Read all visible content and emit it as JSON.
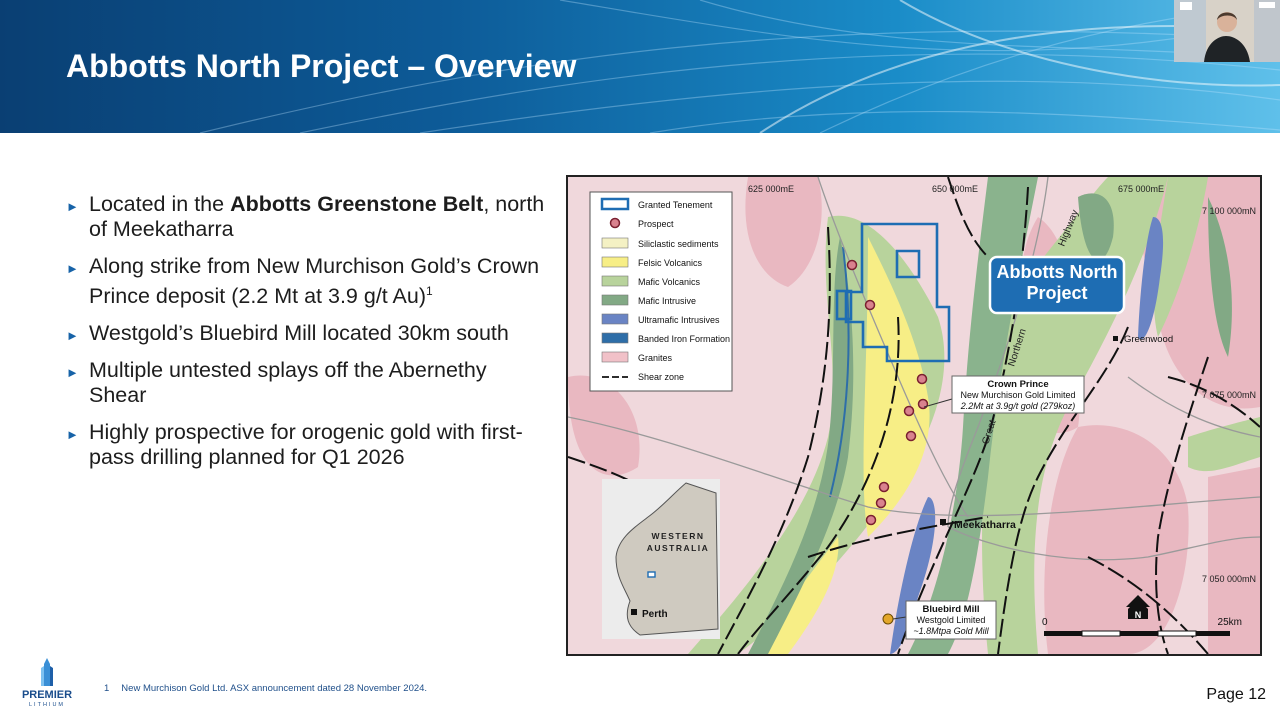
{
  "slide": {
    "title": "Abbotts North Project – Overview",
    "page_label": "Page 12",
    "bullets": [
      {
        "pre": "Located in the ",
        "bold": "Abbotts Greenstone Belt",
        "post": ", north of Meekatharra",
        "sup": ""
      },
      {
        "pre": "Along strike from New Murchison Gold’s Crown Prince deposit (2.2 Mt at 3.9 g/t Au)",
        "bold": "",
        "post": "",
        "sup": "1"
      },
      {
        "pre": "Westgold’s Bluebird Mill located 30km south",
        "bold": "",
        "post": "",
        "sup": ""
      },
      {
        "pre": "Multiple untested splays off the Abernethy Shear",
        "bold": "",
        "post": "",
        "sup": ""
      },
      {
        "pre": "Highly prospective for orogenic gold with first-pass drilling planned for Q1 2026",
        "bold": "",
        "post": "",
        "sup": ""
      }
    ],
    "footnote": {
      "number": "1",
      "text": "New Murchison Gold Ltd. ASX announcement dated 28 November 2024."
    },
    "logo": {
      "line1": "PREMIER",
      "line2": "LITHIUM"
    }
  },
  "map": {
    "legend": [
      {
        "label": "Granted Tenement",
        "swatch": "tenement"
      },
      {
        "label": "Prospect",
        "swatch": "prospect"
      },
      {
        "label": "Siliclastic sediments",
        "color": "#f4f1c4"
      },
      {
        "label": "Felsic Volcanics",
        "color": "#f7ee86"
      },
      {
        "label": "Mafic Volcanics",
        "color": "#b8d39c"
      },
      {
        "label": "Mafic Intrusive",
        "color": "#82a985"
      },
      {
        "label": "Ultramafic Intrusives",
        "color": "#6a84c4"
      },
      {
        "label": "Banded Iron Formation",
        "color": "#2e6ea8"
      },
      {
        "label": "Granites",
        "color": "#f1c1c8"
      },
      {
        "label": "Shear zone",
        "swatch": "shear"
      }
    ],
    "easting_labels": [
      "625 000mE",
      "650 000mE",
      "675 000mE"
    ],
    "northing_labels": [
      "7 100 000mN",
      "7 075 000mN",
      "7 050 000mN"
    ],
    "project_label": {
      "line1": "Abbotts North",
      "line2": "Project"
    },
    "crown_prince": {
      "name": "Crown Prince",
      "owner": "New Murchison Gold Limited",
      "detail": "2.2Mt at 3.9g/t gold (279koz)"
    },
    "bluebird": {
      "name": "Bluebird Mill",
      "owner": "Westgold Limited",
      "detail": "~1.8Mtpa Gold Mill"
    },
    "towns": [
      "Meekatharra",
      "Greenwood"
    ],
    "highway": [
      "Great",
      "Northern",
      "Highway"
    ],
    "inset": {
      "state_line1": "WESTERN",
      "state_line2": "AUSTRALIA",
      "city": "Perth"
    },
    "scale": {
      "start": "0",
      "end": "25km"
    },
    "north": "N"
  },
  "colors": {
    "banner": "#0d5b98",
    "bullet_arrow": "#1763a8",
    "project_box": "#1e6db3",
    "tenement": "#1e6db3"
  }
}
